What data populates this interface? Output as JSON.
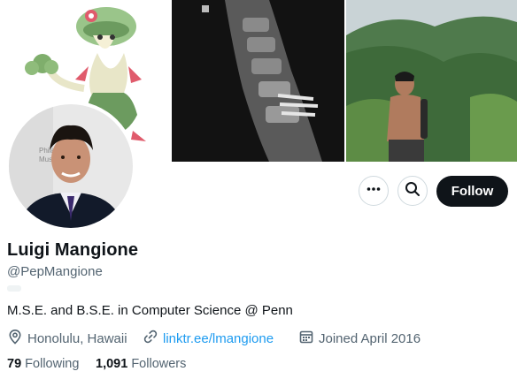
{
  "profile": {
    "name": "Luigi Mangione",
    "handle": "@PepMangione",
    "bio": "M.S.E. and B.S.E. in Computer Science @ Penn",
    "location": "Honolulu, Hawaii",
    "link": "linktr.ee/lmangione",
    "joined": "Joined April 2016",
    "following_count": "79",
    "following_label": "Following",
    "followers_count": "1,091",
    "followers_label": "Followers"
  },
  "actions": {
    "follow_label": "Follow",
    "more_icon": "more-icon",
    "search_icon": "search-icon"
  },
  "header_photos": [
    "cartoon-creature-illustration",
    "spine-x-ray",
    "hiker-on-mountain-ridge"
  ],
  "colors": {
    "link": "#1d9bf0",
    "secondary_text": "#536471",
    "primary_text": "#0f1419",
    "button_dark": "#0f1419",
    "border": "#cfd9de"
  }
}
